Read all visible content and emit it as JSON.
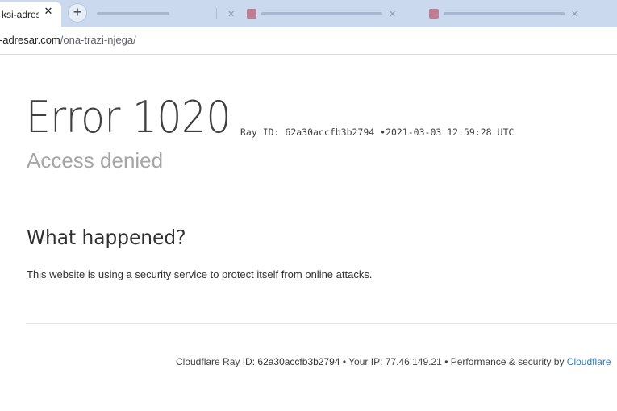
{
  "browser": {
    "active_tab": {
      "title": "ksi-adres",
      "close_icon": "close-icon"
    },
    "new_tab_icon": "plus-icon",
    "address_bar": {
      "host": "i-adresar.com",
      "path": "/ona-trazi-njega/"
    }
  },
  "page": {
    "error_code": "Error 1020",
    "ray_prefix": "Ray ID:",
    "ray_id": "62a30accfb3b2794",
    "separator": "•",
    "timestamp": "2021-03-03 12:59:28 UTC",
    "subtitle": "Access denied",
    "section_heading": "What happened?",
    "description": "This website is using a security service to protect itself from online attacks."
  },
  "footer": {
    "ray_label": "Cloudflare Ray ID:",
    "ray_id": "62a30accfb3b2794",
    "sep1": "•",
    "ip_label": "Your IP:",
    "ip": "77.46.149.21",
    "sep2": "•",
    "perf_label": "Performance & security by",
    "cloudflare_link": "Cloudflare"
  },
  "colors": {
    "tabbar_bg": "#cbd9ee",
    "heading": "#404040",
    "subtitle": "#a6a6a6",
    "link": "#2f7bbf"
  }
}
